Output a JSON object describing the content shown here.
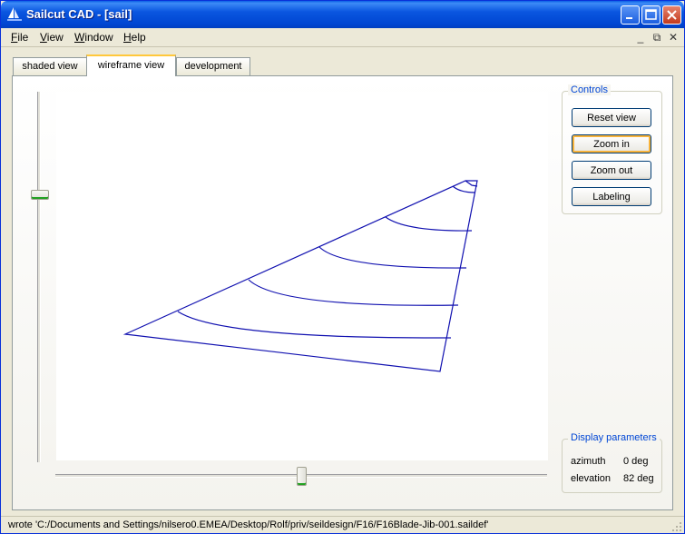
{
  "window": {
    "title": "Sailcut CAD - [sail]"
  },
  "menu": {
    "items": [
      "File",
      "View",
      "Window",
      "Help"
    ]
  },
  "mdi_controls": {
    "minimize": "_",
    "restore": "⧉",
    "close": "✕"
  },
  "tabs": [
    {
      "label": "shaded view",
      "active": false
    },
    {
      "label": "wireframe view",
      "active": true
    },
    {
      "label": "development",
      "active": false
    }
  ],
  "controls": {
    "title": "Controls",
    "buttons": [
      "Reset view",
      "Zoom in",
      "Zoom out",
      "Labeling"
    ]
  },
  "display_parameters": {
    "title": "Display parameters",
    "azimuth_label": "azimuth",
    "azimuth_value": "0 deg",
    "elevation_label": "elevation",
    "elevation_value": "82 deg"
  },
  "sliders": {
    "elevation_level": 0.74,
    "azimuth_level": 0.5
  },
  "status": {
    "text": "wrote 'C:/Documents and Settings/nilsero0.EMEA/Desktop/Rolf/priv/seildesign/F16/F16Blade-Jib-001.saildef'"
  },
  "colors": {
    "wireframe": "#1010b0",
    "accent": "#0046d5",
    "title_bar": "#0a56e0"
  }
}
